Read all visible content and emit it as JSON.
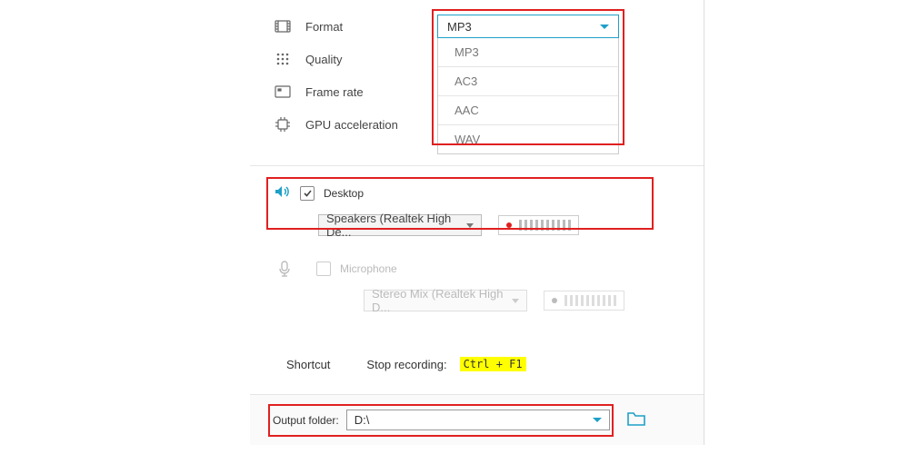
{
  "settings": {
    "format": {
      "label": "Format",
      "selected": "MP3",
      "options": [
        "MP3",
        "AC3",
        "AAC",
        "WAV"
      ]
    },
    "quality": {
      "label": "Quality"
    },
    "frame_rate": {
      "label": "Frame rate"
    },
    "gpu": {
      "label": "GPU acceleration"
    }
  },
  "audio": {
    "desktop": {
      "label": "Desktop",
      "checked": true,
      "device": "Speakers (Realtek High De..."
    },
    "microphone": {
      "label": "Microphone",
      "checked": false,
      "device": "Stereo Mix (Realtek High D..."
    }
  },
  "shortcut": {
    "label": "Shortcut",
    "stop_label": "Stop recording:",
    "stop_key": "Ctrl + F1"
  },
  "output": {
    "label": "Output folder:",
    "value": "D:\\"
  }
}
